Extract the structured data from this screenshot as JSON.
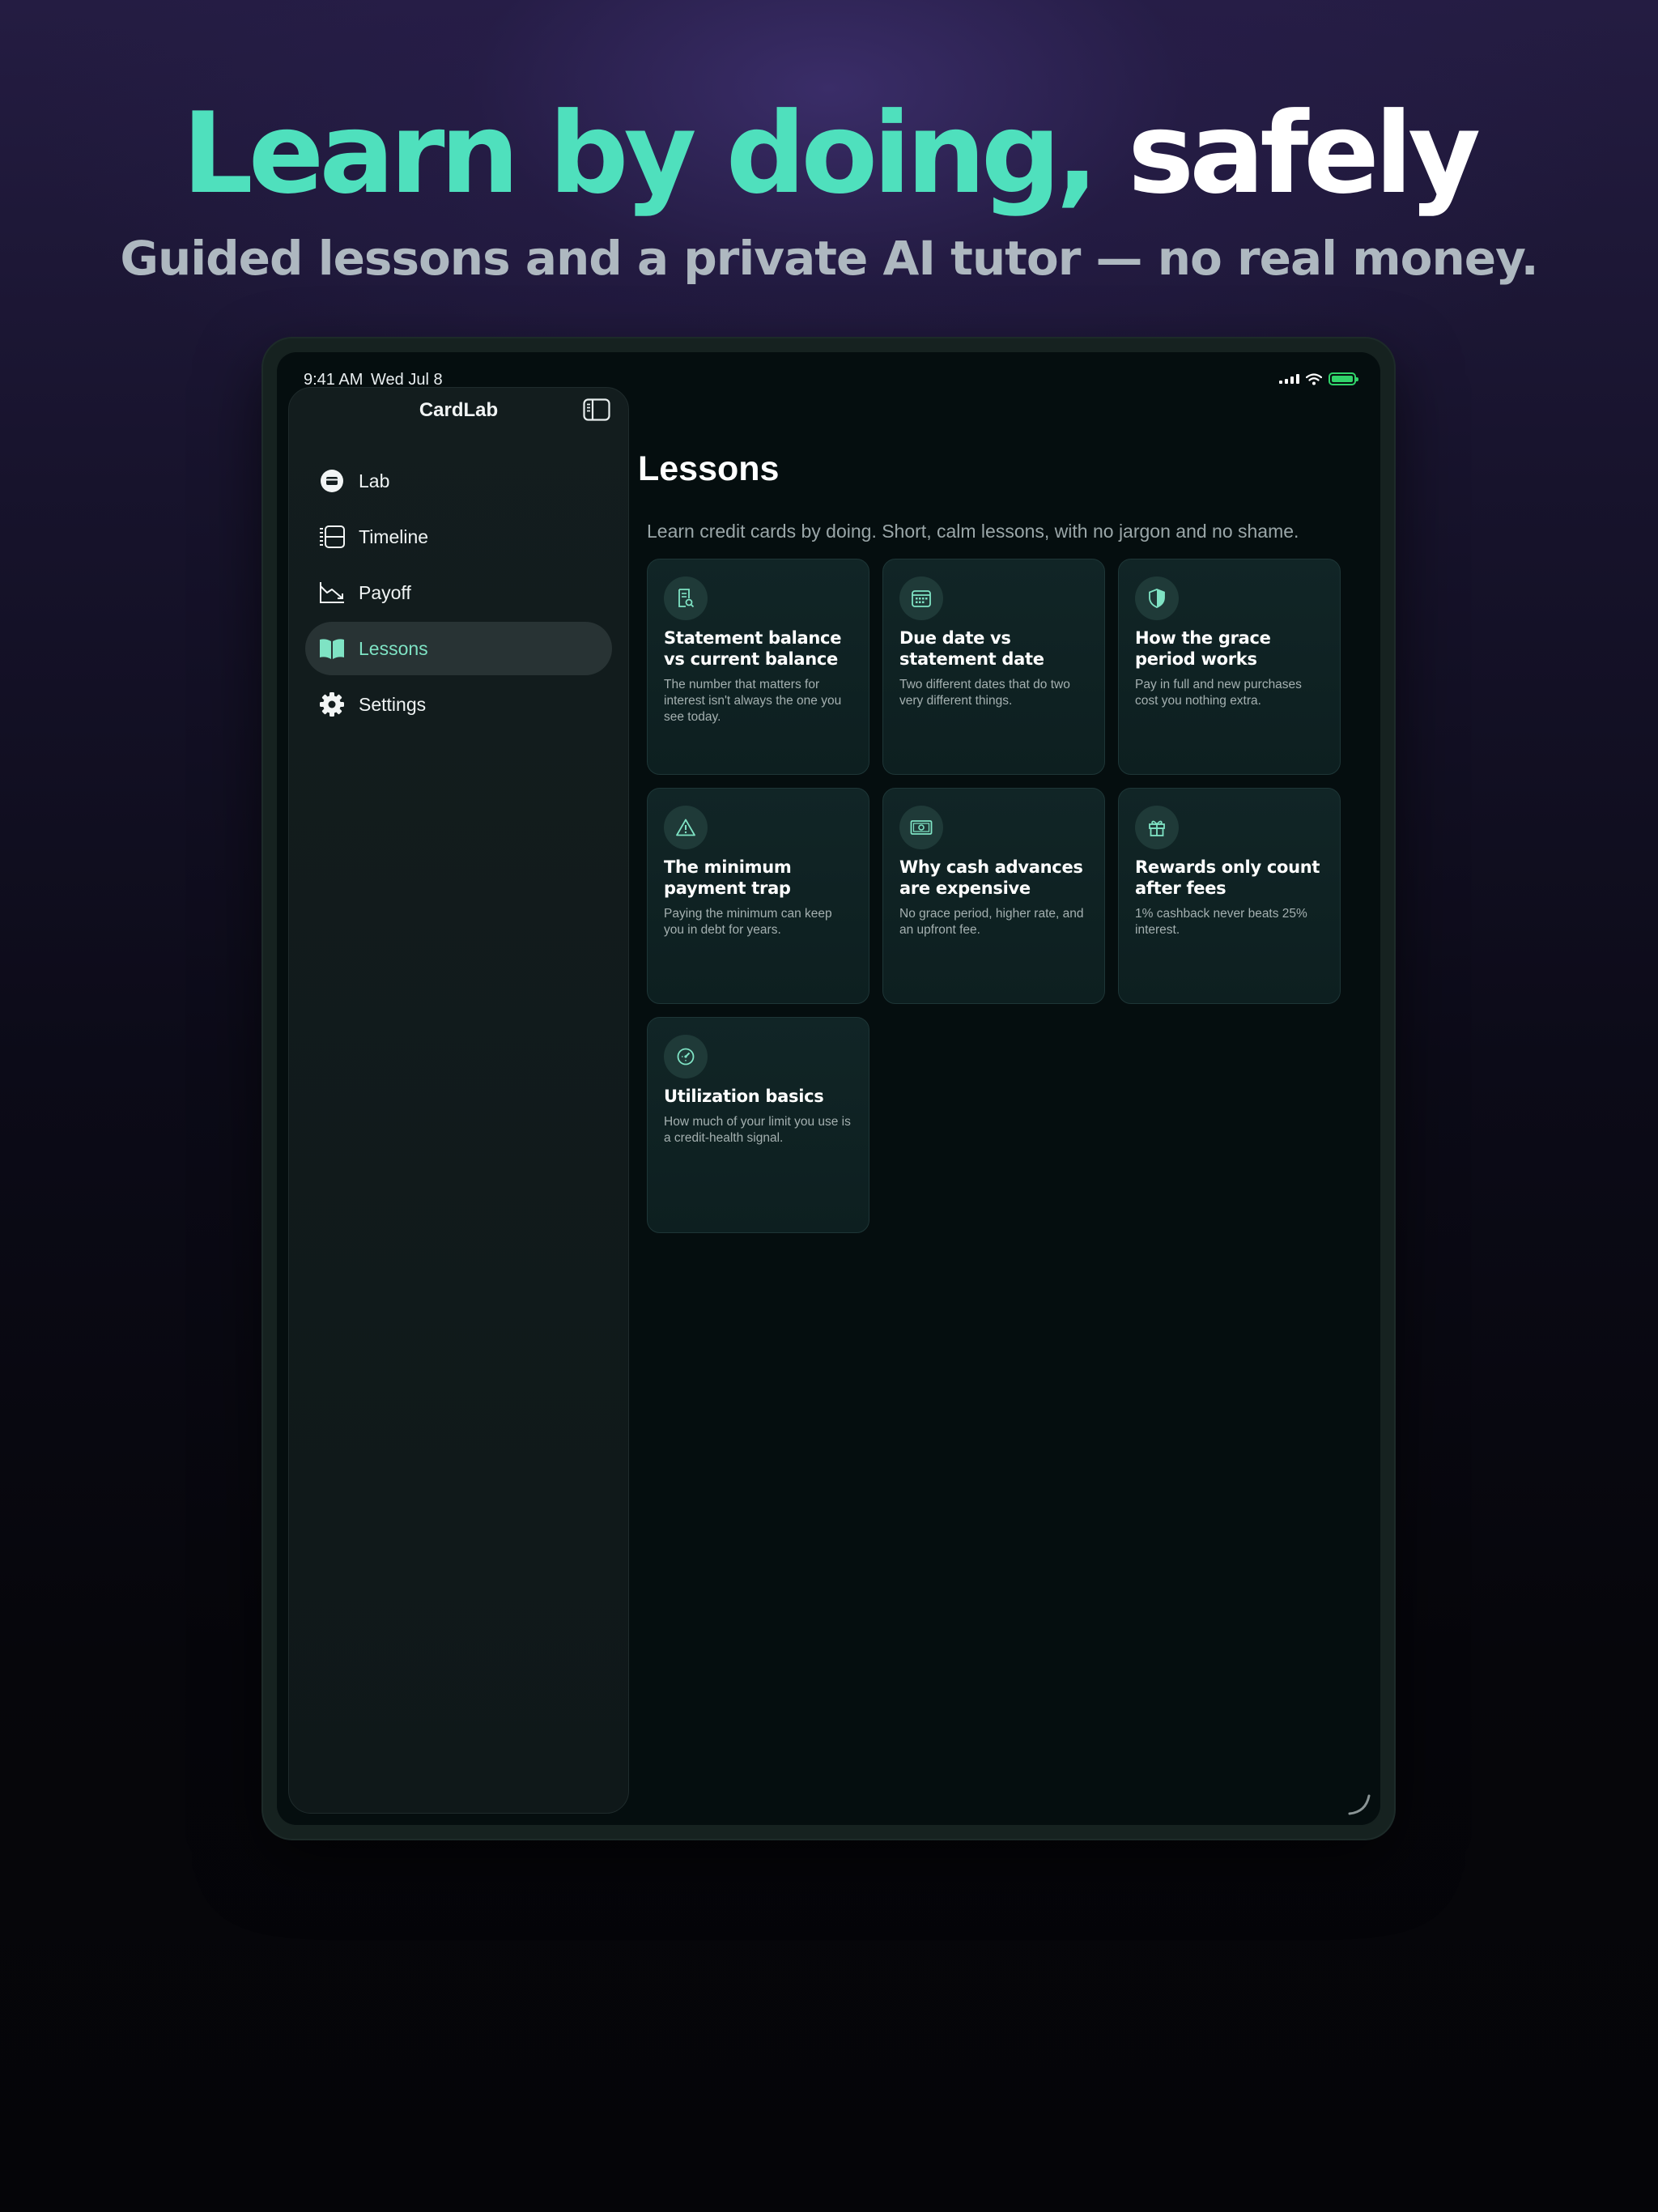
{
  "hero": {
    "headline_green": "Learn by doing,",
    "headline_white": "safely",
    "subheadline": "Guided lessons and a private AI tutor — no real money."
  },
  "status_bar": {
    "time": "9:41 AM",
    "date": "Wed Jul 8"
  },
  "sidebar": {
    "title": "CardLab",
    "items": [
      {
        "label": "Lab",
        "icon": "credit-card-circle-icon",
        "active": false
      },
      {
        "label": "Timeline",
        "icon": "timeline-list-icon",
        "active": false
      },
      {
        "label": "Payoff",
        "icon": "chart-down-icon",
        "active": false
      },
      {
        "label": "Lessons",
        "icon": "book-open-icon",
        "active": true
      },
      {
        "label": "Settings",
        "icon": "gear-icon",
        "active": false
      }
    ]
  },
  "main": {
    "title": "Lessons",
    "subtitle": "Learn credit cards by doing. Short, calm lessons, with no jargon and no shame.",
    "lessons": [
      {
        "title": "Statement balance vs current balance",
        "body": "The number that matters for interest isn't always the one you see today.",
        "icon": "receipt-search-icon"
      },
      {
        "title": "Due date vs statement date",
        "body": "Two different dates that do two very different things.",
        "icon": "calendar-icon"
      },
      {
        "title": "How the grace period works",
        "body": "Pay in full and new purchases cost you nothing extra.",
        "icon": "shield-icon"
      },
      {
        "title": "The minimum payment trap",
        "body": "Paying the minimum can keep you in debt for years.",
        "icon": "warning-triangle-icon"
      },
      {
        "title": "Why cash advances are expensive",
        "body": "No grace period, higher rate, and an upfront fee.",
        "icon": "banknote-icon"
      },
      {
        "title": "Rewards only count after fees",
        "body": "1% cashback never beats 25% interest.",
        "icon": "gift-icon"
      },
      {
        "title": "Utilization basics",
        "body": "How much of your limit you use is a credit-health signal.",
        "icon": "gauge-icon"
      }
    ]
  },
  "colors": {
    "accent": "#4fe0bd",
    "active_label": "#7fe3c4",
    "battery": "#31d36a"
  }
}
